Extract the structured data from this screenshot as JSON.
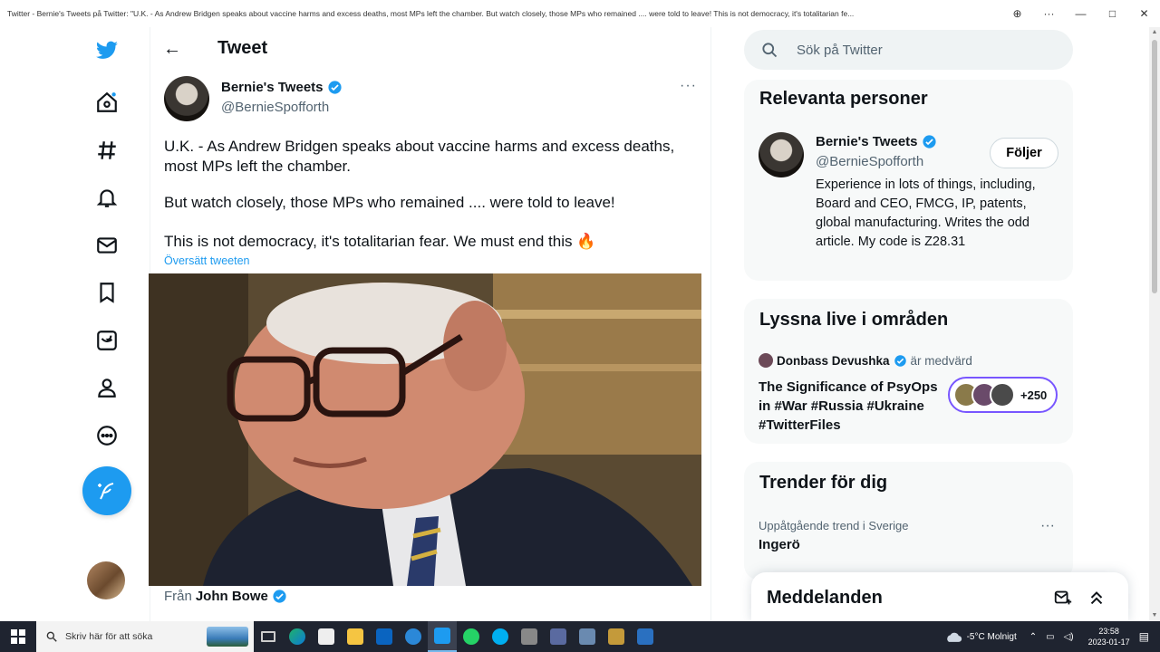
{
  "window": {
    "title": "Twitter - Bernie's Tweets på Twitter: \"U.K. - As Andrew Bridgen speaks about vaccine harms and excess deaths, most MPs left the chamber. But watch closely, those MPs who remained .... were told to leave! This is not democracy, it's totalitarian fe...",
    "btn_zoom": "⊕",
    "btn_more": "···",
    "btn_min": "—",
    "btn_max": "□",
    "btn_close": "✕"
  },
  "nav": {
    "icons": [
      "twitter-logo-icon",
      "home-icon",
      "explore-hashtag-icon",
      "notifications-bell-icon",
      "messages-envelope-icon",
      "bookmarks-icon",
      "twitter-blue-icon",
      "profile-icon",
      "more-circle-icon",
      "compose-tweet-icon"
    ]
  },
  "header": {
    "back": "←",
    "title": "Tweet"
  },
  "tweet": {
    "author_name": "Bernie's Tweets",
    "author_handle": "@BernieSpofforth",
    "more": "···",
    "para1": "U.K. - As Andrew Bridgen speaks about vaccine harms and excess deaths, most MPs left the chamber.",
    "para2": "But watch closely, those MPs who remained .... were told to leave!",
    "para3": "This is not democracy, it's totalitarian fear. We must end this 🔥",
    "translate": "Översätt tweeten",
    "from_prefix": "Från",
    "from_name": "John Bowe"
  },
  "search": {
    "placeholder": "Sök på Twitter"
  },
  "relevant": {
    "heading": "Relevanta personer",
    "name": "Bernie's Tweets",
    "handle": "@BernieSpofforth",
    "bio": "Experience in lots of things, including, Board and CEO, FMCG, IP, patents, global manufacturing. Writes the odd article. My code is Z28.31",
    "follow": "Följer"
  },
  "spaces": {
    "heading": "Lyssna live i områden",
    "host": "Donbass Devushka",
    "role": "är medvärd",
    "title": "The Significance of PsyOps in #War #Russia #Ukraine #TwitterFiles",
    "listeners": "+250"
  },
  "trends": {
    "heading": "Trender för dig",
    "context": "Uppåtgående trend i Sverige",
    "name": "Ingerö",
    "more": "···"
  },
  "messages": {
    "label": "Meddelanden"
  },
  "taskbar": {
    "search_placeholder": "Skriv här för att söka",
    "weather": "-5°C  Molnigt",
    "time": "23:58",
    "date": "2023-01-17"
  },
  "colors": {
    "accent": "#1d9bf0",
    "spaces": "#7856ff"
  }
}
